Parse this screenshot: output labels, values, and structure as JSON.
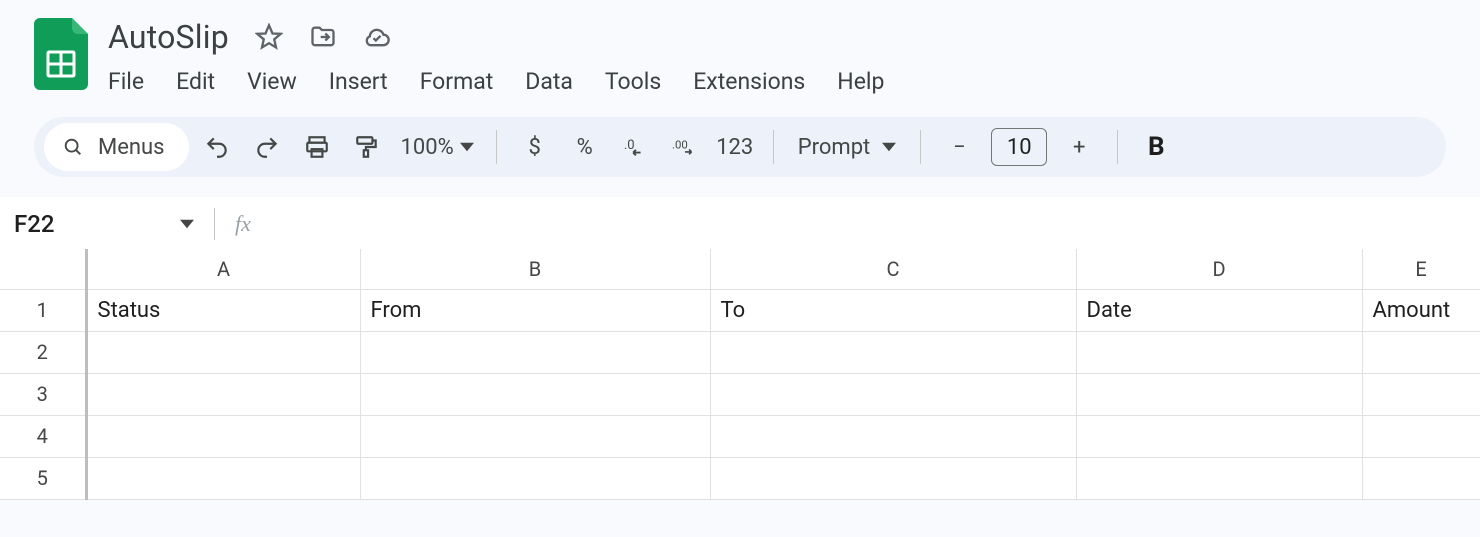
{
  "document": {
    "title": "AutoSlip"
  },
  "menus": {
    "items": [
      "File",
      "Edit",
      "View",
      "Insert",
      "Format",
      "Data",
      "Tools",
      "Extensions",
      "Help"
    ]
  },
  "toolbar": {
    "menus_label": "Menus",
    "zoom": "100%",
    "currency": "$",
    "percent": "%",
    "dec_decrease": ".0",
    "dec_increase": ".00",
    "numfmt": "123",
    "font_name": "Prompt",
    "font_size": "10",
    "minus": "−",
    "plus": "+",
    "bold": "B"
  },
  "formula_bar": {
    "name_box": "F22",
    "fx_label": "fx",
    "value": ""
  },
  "sheet": {
    "columns": [
      "A",
      "B",
      "C",
      "D",
      "E"
    ],
    "rows": [
      "1",
      "2",
      "3",
      "4",
      "5"
    ],
    "data": [
      [
        "Status",
        "From",
        "To",
        "Date",
        "Amount"
      ],
      [
        "",
        "",
        "",
        "",
        ""
      ],
      [
        "",
        "",
        "",
        "",
        ""
      ],
      [
        "",
        "",
        "",
        "",
        ""
      ],
      [
        "",
        "",
        "",
        "",
        ""
      ]
    ]
  }
}
